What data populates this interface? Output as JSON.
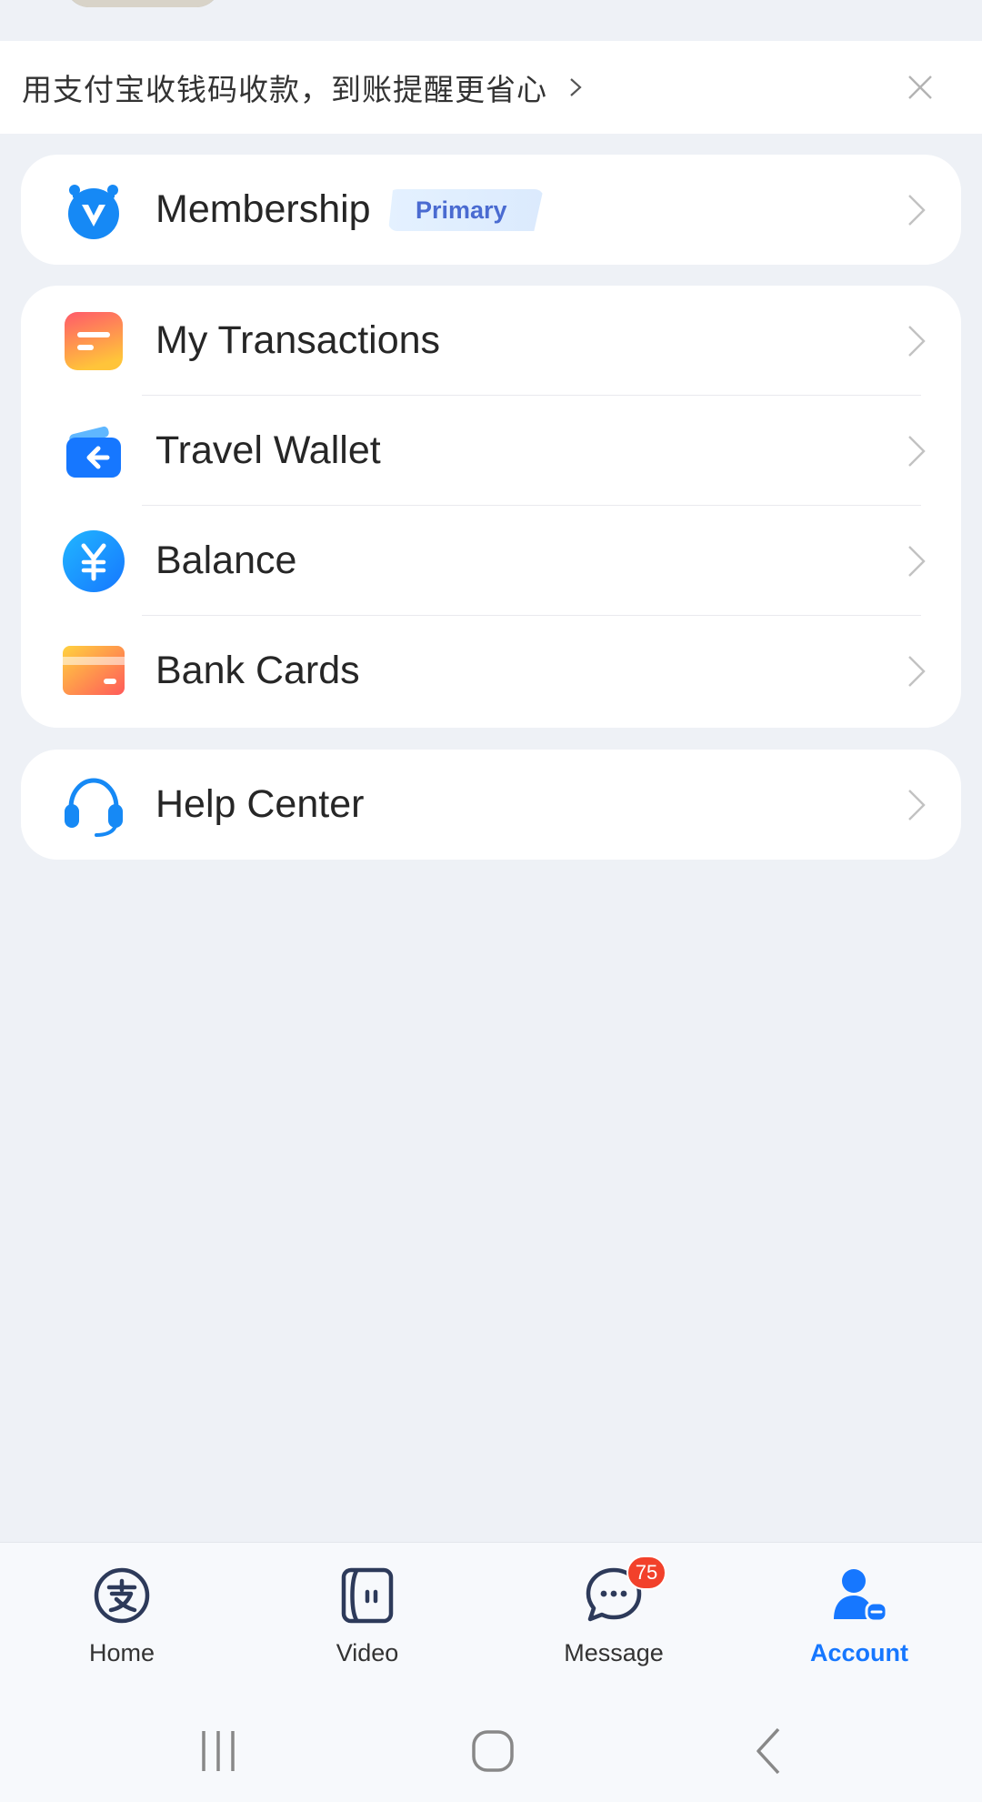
{
  "banner": {
    "text": "用支付宝收钱码收款，到账提醒更省心"
  },
  "membership": {
    "label": "Membership",
    "badge": "Primary"
  },
  "menu": {
    "items": [
      {
        "label": "My Transactions",
        "icon": "transactions-icon"
      },
      {
        "label": "Travel Wallet",
        "icon": "travel-wallet-icon"
      },
      {
        "label": "Balance",
        "icon": "balance-icon"
      },
      {
        "label": "Bank Cards",
        "icon": "bank-cards-icon"
      }
    ]
  },
  "help": {
    "label": "Help Center"
  },
  "bottom_nav": {
    "items": [
      {
        "label": "Home",
        "icon": "home-alipay-icon",
        "active": false
      },
      {
        "label": "Video",
        "icon": "video-icon",
        "active": false
      },
      {
        "label": "Message",
        "icon": "message-icon",
        "active": false,
        "badge": "75"
      },
      {
        "label": "Account",
        "icon": "account-icon",
        "active": true
      }
    ]
  },
  "colors": {
    "accent": "#1677ff",
    "background": "#eef1f6",
    "badge_red": "#f2412b",
    "primary_badge_text": "#4a6bd1"
  }
}
